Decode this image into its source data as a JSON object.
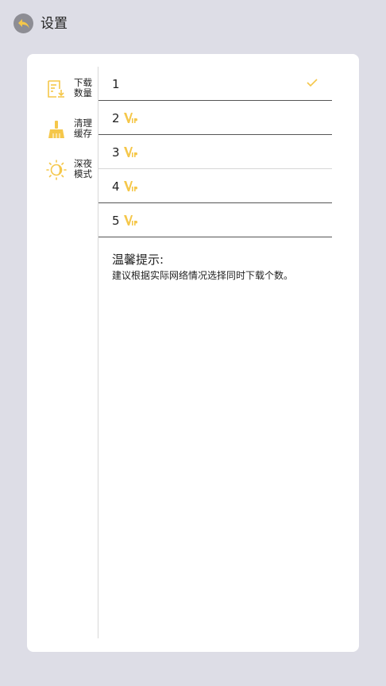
{
  "header": {
    "title": "设置",
    "back_icon": "back-arrow-icon"
  },
  "sidebar": {
    "items": [
      {
        "label": "下载数量",
        "icon": "download-document-icon"
      },
      {
        "label": "清理缓存",
        "icon": "broom-icon"
      },
      {
        "label": "深夜模式",
        "icon": "night-mode-icon"
      }
    ]
  },
  "download_options": {
    "selected": "1",
    "options": [
      {
        "value": "1",
        "vip": false
      },
      {
        "value": "2",
        "vip": true
      },
      {
        "value": "3",
        "vip": true
      },
      {
        "value": "4",
        "vip": true
      },
      {
        "value": "5",
        "vip": true
      }
    ]
  },
  "tips": {
    "title": "温馨提示:",
    "body": "建议根据实际网络情况选择同时下载个数。"
  },
  "colors": {
    "accent": "#f5c74a",
    "background": "#dddde6",
    "card": "#ffffff"
  }
}
